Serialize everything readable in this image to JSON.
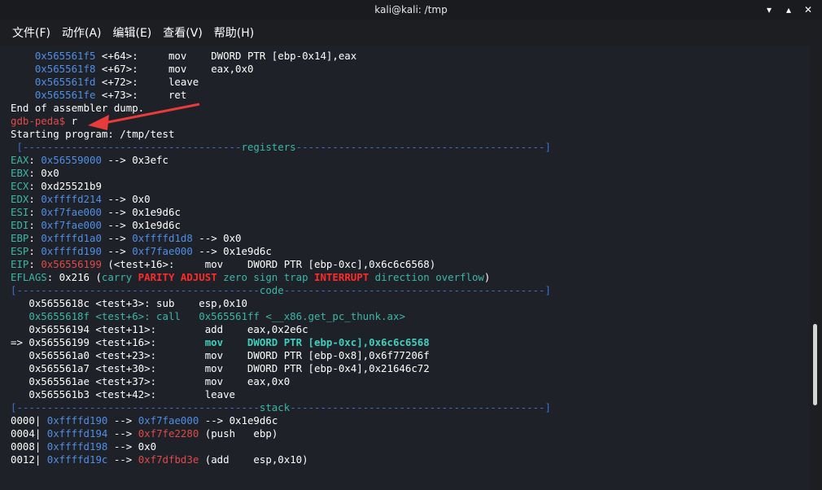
{
  "window": {
    "title": "kali@kali: /tmp",
    "minimize": "▾",
    "restore": "▴",
    "close": "✕"
  },
  "menu": [
    "文件(F)",
    "动作(A)",
    "编辑(E)",
    "查看(V)",
    "帮助(H)"
  ],
  "colors": {
    "background": "#1e2127",
    "address_blue": "#4f8fe6",
    "pointer_red": "#e14a4a",
    "code_cyan": "#3bb7a8",
    "annotation_arrow": "#e83b3b"
  },
  "lines": [
    [
      [
        "    ",
        ""
      ],
      [
        "0x565561f5",
        "blue"
      ],
      [
        " <+64>:     mov    DWORD PTR [ebp-0x14],eax",
        ""
      ]
    ],
    [
      [
        "    ",
        ""
      ],
      [
        "0x565561f8",
        "blue"
      ],
      [
        " <+67>:     mov    eax,0x0",
        ""
      ]
    ],
    [
      [
        "    ",
        ""
      ],
      [
        "0x565561fd",
        "blue"
      ],
      [
        " <+72>:     leave",
        ""
      ]
    ],
    [
      [
        "    ",
        ""
      ],
      [
        "0x565561fe",
        "blue"
      ],
      [
        " <+73>:     ret",
        ""
      ]
    ],
    [
      [
        "End of assembler dump.",
        ""
      ]
    ],
    [
      [
        "gdb-peda$ ",
        "red"
      ],
      [
        "r",
        ""
      ]
    ],
    [
      [
        "Starting program: /tmp/test",
        ""
      ]
    ],
    [
      [
        " [",
        "sep"
      ],
      [
        "------------------------------------",
        "sep"
      ],
      [
        "registers",
        "cyan"
      ],
      [
        "-----------------------------------------]",
        "sep"
      ]
    ],
    [
      [
        "EAX",
        "cyan"
      ],
      [
        ": ",
        ""
      ],
      [
        "0x56559000",
        "blue"
      ],
      [
        " --> 0x3efc",
        ""
      ]
    ],
    [
      [
        "EBX",
        "cyan"
      ],
      [
        ": 0x0",
        ""
      ]
    ],
    [
      [
        "ECX",
        "cyan"
      ],
      [
        ": 0xd25521b9",
        ""
      ]
    ],
    [
      [
        "EDX",
        "cyan"
      ],
      [
        ": ",
        ""
      ],
      [
        "0xffffd214",
        "blue"
      ],
      [
        " --> 0x0",
        ""
      ]
    ],
    [
      [
        "ESI",
        "cyan"
      ],
      [
        ": ",
        ""
      ],
      [
        "0xf7fae000",
        "blue"
      ],
      [
        " --> 0x1e9d6c",
        ""
      ]
    ],
    [
      [
        "EDI",
        "cyan"
      ],
      [
        ": ",
        ""
      ],
      [
        "0xf7fae000",
        "blue"
      ],
      [
        " --> 0x1e9d6c",
        ""
      ]
    ],
    [
      [
        "EBP",
        "cyan"
      ],
      [
        ": ",
        ""
      ],
      [
        "0xffffd1a0",
        "blue"
      ],
      [
        " --> ",
        ""
      ],
      [
        "0xffffd1d8",
        "blue"
      ],
      [
        " --> 0x0",
        ""
      ]
    ],
    [
      [
        "ESP",
        "cyan"
      ],
      [
        ": ",
        ""
      ],
      [
        "0xffffd190",
        "blue"
      ],
      [
        " --> ",
        ""
      ],
      [
        "0xf7fae000",
        "blue"
      ],
      [
        " --> 0x1e9d6c",
        ""
      ]
    ],
    [
      [
        "EIP",
        "cyan"
      ],
      [
        ": ",
        ""
      ],
      [
        "0x56556199",
        "red"
      ],
      [
        " (<test+16>:     mov    DWORD PTR [ebp-0xc],0x6c6c6568)",
        ""
      ]
    ],
    [
      [
        "EFLAGS",
        "cyan"
      ],
      [
        ": 0x216 (",
        ""
      ],
      [
        "carry ",
        "cyan"
      ],
      [
        "PARITY ADJUST",
        "redb"
      ],
      [
        " zero sign trap ",
        "cyan"
      ],
      [
        "INTERRUPT",
        "redb"
      ],
      [
        " direction overflow",
        "cyan"
      ],
      [
        ")",
        ""
      ]
    ],
    [
      [
        "[",
        "sep"
      ],
      [
        "----------------------------------------",
        "sep"
      ],
      [
        "code",
        "cyan"
      ],
      [
        "-------------------------------------------]",
        "sep"
      ]
    ],
    [
      [
        "   0x5655618c <test+3>: sub    esp,0x10",
        ""
      ]
    ],
    [
      [
        "   0x5655618f <test+6>: ",
        "cyan"
      ],
      [
        "call   0x565561ff <__x86.get_pc_thunk.ax>",
        "cyan"
      ]
    ],
    [
      [
        "   0x56556194 <test+11>:        add    eax,0x2e6c",
        ""
      ]
    ],
    [
      [
        "=> 0x56556199 <test+16>:        ",
        ""
      ],
      [
        "mov    DWORD PTR [ebp-0xc],0x6c6c6568",
        "cyanb"
      ]
    ],
    [
      [
        "   0x565561a0 <test+23>:        mov    DWORD PTR [ebp-0x8],0x6f77206f",
        ""
      ]
    ],
    [
      [
        "   0x565561a7 <test+30>:        mov    DWORD PTR [ebp-0x4],0x21646c72",
        ""
      ]
    ],
    [
      [
        "   0x565561ae <test+37>:        mov    eax,0x0",
        ""
      ]
    ],
    [
      [
        "   0x565561b3 <test+42>:        leave",
        ""
      ]
    ],
    [
      [
        "[",
        "sep"
      ],
      [
        "----------------------------------------",
        "sep"
      ],
      [
        "stack",
        "cyan"
      ],
      [
        "------------------------------------------]",
        "sep"
      ]
    ],
    [
      [
        "0000| ",
        ""
      ],
      [
        "0xffffd190",
        "blue"
      ],
      [
        " --> ",
        ""
      ],
      [
        "0xf7fae000",
        "blue"
      ],
      [
        " --> 0x1e9d6c",
        ""
      ]
    ],
    [
      [
        "0004| ",
        ""
      ],
      [
        "0xffffd194",
        "blue"
      ],
      [
        " --> ",
        ""
      ],
      [
        "0xf7fe2280",
        "red"
      ],
      [
        " (push   ebp)",
        ""
      ]
    ],
    [
      [
        "0008| ",
        ""
      ],
      [
        "0xffffd198",
        "blue"
      ],
      [
        " --> 0x0",
        ""
      ]
    ],
    [
      [
        "0012| ",
        ""
      ],
      [
        "0xffffd19c",
        "blue"
      ],
      [
        " --> ",
        ""
      ],
      [
        "0xf7dfbd3e",
        "red"
      ],
      [
        " (add    esp,0x10)",
        ""
      ]
    ]
  ]
}
